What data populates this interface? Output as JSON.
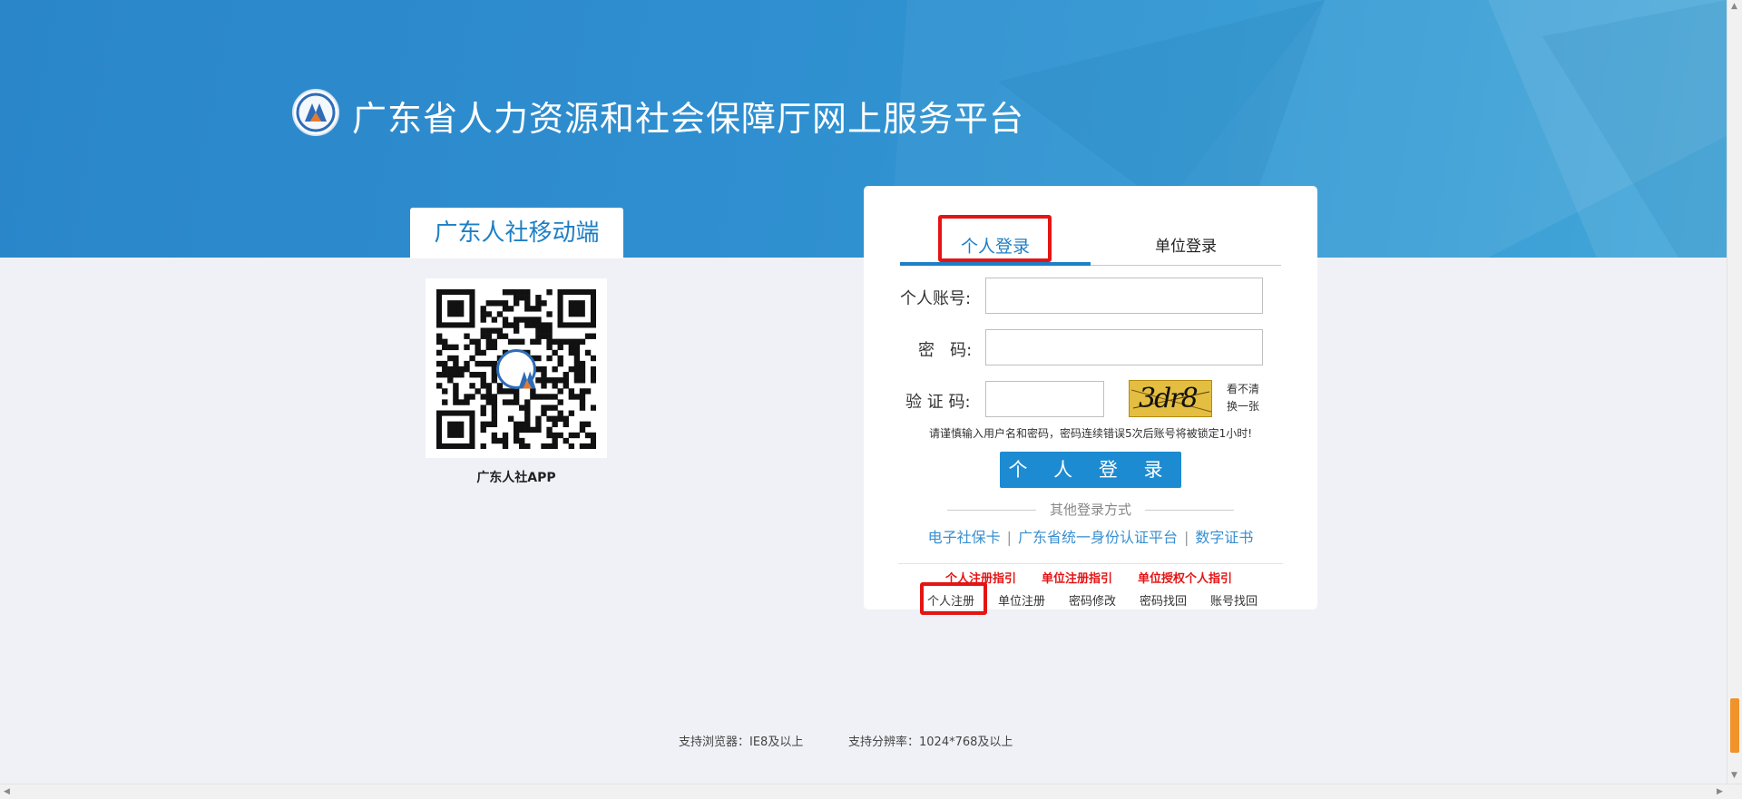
{
  "header": {
    "title": "广东省人力资源和社会保障厅网上服务平台",
    "logo_icon": "hrss-emblem-icon"
  },
  "mobile": {
    "tab_label": "广东人社移动端",
    "qr_caption": "广东人社APP",
    "qr_icon": "qr-code-icon"
  },
  "login": {
    "tabs": [
      {
        "label": "个人登录"
      },
      {
        "label": "单位登录"
      }
    ],
    "account_label": "个人账号:",
    "password_label": "密   码:",
    "captcha_label": "验 证 码:",
    "account_value": "",
    "password_value": "",
    "captcha_value": "",
    "captcha_text": "3dr8",
    "refresh_line1": "看不清",
    "refresh_line2": "换一张",
    "warning": "请谨慎输入用户名和密码，密码连续错误5次后账号将被锁定1小时!",
    "submit_label": "个 人 登 录",
    "other_title": "其他登录方式",
    "other_methods": [
      "电子社保卡",
      "广东省统一身份认证平台",
      "数字证书"
    ],
    "guides": [
      "个人注册指引",
      "单位注册指引",
      "单位授权个人指引"
    ],
    "bottom_links": [
      "个人注册",
      "单位注册",
      "密码修改",
      "密码找回",
      "账号找回"
    ]
  },
  "footer": {
    "browser": "支持浏览器：IE8及以上",
    "resolution": "支持分辨率：1024*768及以上"
  },
  "colors": {
    "accent": "#1d8bd1",
    "banner": "#2f8fd0",
    "highlight": "#e51414",
    "guide": "#e51414",
    "background": "#f0f1f6"
  }
}
